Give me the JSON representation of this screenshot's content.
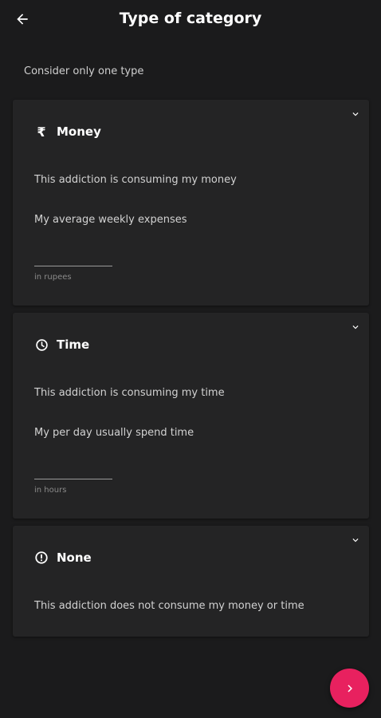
{
  "header": {
    "back_icon": "arrow-left-icon",
    "title": "Type of category"
  },
  "hint": "Consider only one type",
  "cards": [
    {
      "icon": "rupee-icon",
      "icon_glyph": "₹",
      "title": "Money",
      "description": "This addiction is consuming my money",
      "field_label": "My average weekly expenses",
      "field_value": "",
      "field_helper": "in rupees"
    },
    {
      "icon": "clock-icon",
      "title": "Time",
      "description": "This addiction is consuming my time",
      "field_label": "My per day usually spend time",
      "field_value": "",
      "field_helper": "in hours"
    },
    {
      "icon": "alert-circle-icon",
      "title": "None",
      "description": "This addiction does not consume my money or time"
    }
  ],
  "fab": {
    "icon": "chevron-right-icon",
    "color": "#e8215f"
  },
  "colors": {
    "background": "#1b1b1c",
    "card": "#242425",
    "accent": "#e8215f"
  }
}
